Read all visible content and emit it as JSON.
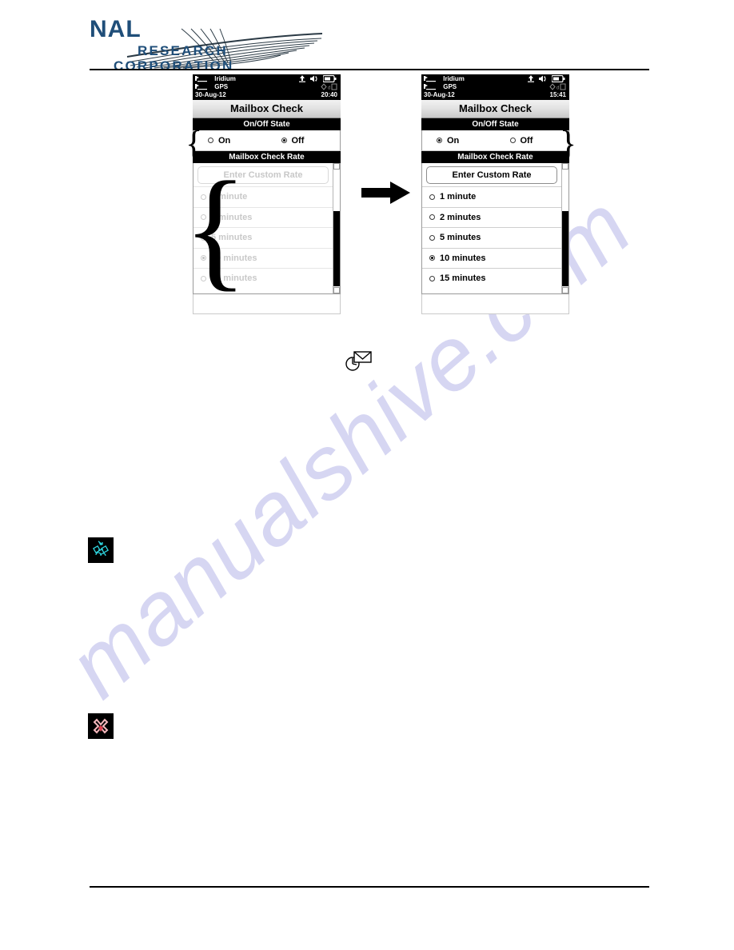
{
  "document": {
    "watermark_text": "manualshive.com",
    "watermark_color": "#d6d6f2"
  },
  "header": {
    "logo": {
      "line1": "NAL",
      "line2": "RESEARCH",
      "line3": "CORPORATION",
      "color": "#1f4e79"
    }
  },
  "flow": {
    "arrow_icon": "arrow-right-icon"
  },
  "inline_icons": {
    "mailbox_check_icon": "clock-envelope-icon",
    "satellite_note_icon": "satellite-icon",
    "warning_note_icon": "x-cross-icon"
  },
  "braces": {
    "left_top": "{",
    "left_list": "{",
    "right_top": "}"
  },
  "screens": [
    {
      "id": "screen-before",
      "status_bar": {
        "network_label": "Iridium",
        "gps_label": "GPS",
        "date": "30-Aug-12",
        "time": "20:40",
        "icons": [
          "upload-icon",
          "speaker-icon",
          "battery-icon",
          "gps-fix-icon"
        ]
      },
      "title": "Mailbox Check",
      "sections": [
        {
          "header": "On/Off State",
          "options": [
            {
              "label": "On",
              "selected": false
            },
            {
              "label": "Off",
              "selected": true
            }
          ]
        },
        {
          "header": "Mailbox Check Rate",
          "custom_button": "Enter Custom Rate",
          "disabled": true,
          "options": [
            {
              "label": "1 minute",
              "selected": false
            },
            {
              "label": "2 minutes",
              "selected": false
            },
            {
              "label": "5 minutes",
              "selected": false
            },
            {
              "label": "10 minutes",
              "selected": true
            },
            {
              "label": "15 minutes",
              "selected": false
            }
          ]
        }
      ]
    },
    {
      "id": "screen-after",
      "status_bar": {
        "network_label": "Iridium",
        "gps_label": "GPS",
        "date": "30-Aug-12",
        "time": "15:41",
        "icons": [
          "upload-icon",
          "speaker-icon",
          "battery-icon",
          "gps-fix-icon"
        ]
      },
      "title": "Mailbox Check",
      "sections": [
        {
          "header": "On/Off State",
          "options": [
            {
              "label": "On",
              "selected": true
            },
            {
              "label": "Off",
              "selected": false
            }
          ]
        },
        {
          "header": "Mailbox Check Rate",
          "custom_button": "Enter Custom Rate",
          "disabled": false,
          "options": [
            {
              "label": "1 minute",
              "selected": false
            },
            {
              "label": "2 minutes",
              "selected": false
            },
            {
              "label": "5 minutes",
              "selected": false
            },
            {
              "label": "10 minutes",
              "selected": true
            },
            {
              "label": "15 minutes",
              "selected": false
            }
          ]
        }
      ]
    }
  ]
}
